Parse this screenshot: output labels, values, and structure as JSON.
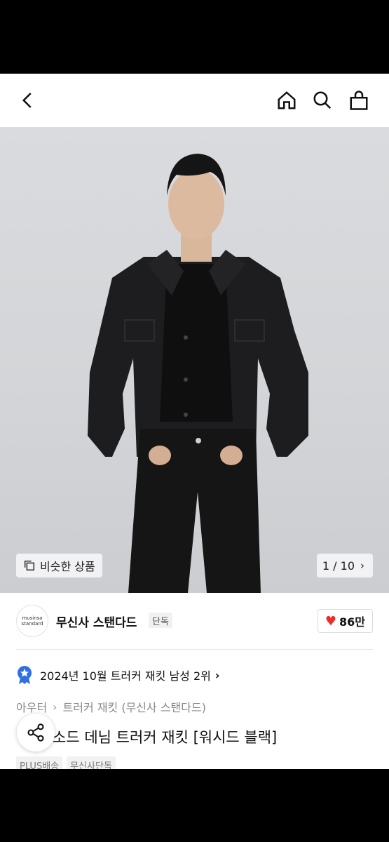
{
  "header": {
    "back_icon": "chevron-left-icon",
    "home_icon": "home-icon",
    "search_icon": "search-icon",
    "bag_icon": "shopping-bag-icon"
  },
  "gallery": {
    "similar_label": "비슷한 상품",
    "counter": "1 / 10",
    "counter_icon": "chevron-right-icon"
  },
  "brand": {
    "logo_line1": "musinsa",
    "logo_line2": "standard",
    "name": "무신사 스탠다드",
    "exclusive_tag": "단독",
    "like_count": "86만",
    "like_color": "#ef2b2b"
  },
  "ranking": {
    "text": "2024년 10월 트러커 재킷 남성 2위",
    "badge_color": "#2f6fe0"
  },
  "breadcrumb": {
    "level1": "아우터",
    "level2": "트러커 재킷 (무신사 스탠다드)"
  },
  "product": {
    "title": "소드 데님 트러커 재킷 [워시드 블랙]"
  },
  "tags": [
    "PLUS배송",
    "무신사단독"
  ]
}
